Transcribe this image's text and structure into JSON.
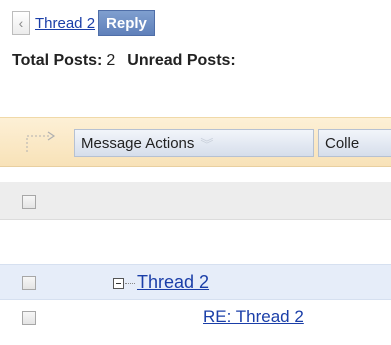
{
  "nav": {
    "back_glyph": "‹",
    "thread_link": "Thread 2",
    "reply_label": "Reply"
  },
  "totals": {
    "total_label": "Total Posts:",
    "total_value": "2",
    "unread_label": "Unread Posts:"
  },
  "toolbar": {
    "message_actions_label": "Message Actions",
    "collect_label": "Colle"
  },
  "posts": [
    {
      "title": "Thread 2"
    },
    {
      "title": "RE: Thread 2"
    }
  ],
  "colors": {
    "link": "#1a3ea8",
    "reply_button": "#6b8cc4",
    "toolbar_bg": "#fbe8c6",
    "selected_row": "#e6edf9"
  }
}
